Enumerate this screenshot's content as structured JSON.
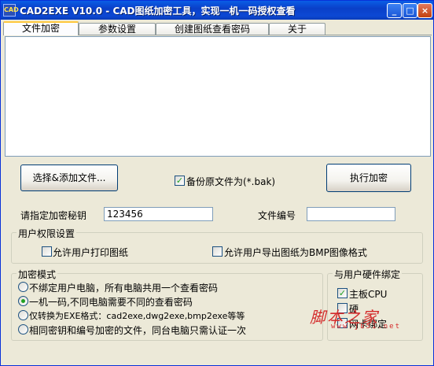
{
  "window": {
    "title": "CAD2EXE V10.0 - CAD图纸加密工具，实现一机一码授权查看",
    "icon_label": "CAD",
    "controls": {
      "minimize": "_",
      "maximize": "□",
      "close": "×"
    }
  },
  "tabs": [
    {
      "label": "文件加密",
      "active": true
    },
    {
      "label": "参数设置",
      "active": false
    },
    {
      "label": "创建图纸查看密码",
      "active": false
    },
    {
      "label": "关于",
      "active": false
    }
  ],
  "file_list": {
    "items": []
  },
  "actions": {
    "add_files_label": "选择&添加文件...",
    "backup_label": "备份原文件为(*.bak)",
    "backup_checked": true,
    "execute_label": "执行加密"
  },
  "fields": {
    "key_label": "请指定加密秘钥",
    "key_value": "123456",
    "file_number_label": "文件编号",
    "file_number_value": ""
  },
  "permissions": {
    "title": "用户权限设置",
    "allow_print_label": "允许用户打印图纸",
    "allow_print_checked": false,
    "allow_export_label": "允许用户导出图纸为BMP图像格式",
    "allow_export_checked": false
  },
  "encryption_mode": {
    "title": "加密模式",
    "options": [
      {
        "label": "不绑定用户电脑，所有电脑共用一个查看密码",
        "selected": false
      },
      {
        "label": "一机一码,不同电脑需要不同的查看密码",
        "selected": true
      },
      {
        "label": "仅转换为EXE格式：cad2exe,dwg2exe,bmp2exe等等",
        "selected": false
      },
      {
        "label": "相同密钥和编号加密的文件，同台电脑只需认证一次",
        "selected": false
      }
    ]
  },
  "hardware_binding": {
    "title": "与用户硬件绑定",
    "options": [
      {
        "label": "主板CPU",
        "checked": true
      },
      {
        "label": "硬",
        "checked": false
      },
      {
        "label": "网卡绑定",
        "checked": false
      }
    ]
  },
  "watermark": {
    "text": "脚本之家",
    "sub": "www.jb51.net"
  },
  "colors": {
    "titlebar": "#0a3fc8",
    "window_bg": "#ece9d8",
    "check_mark": "#21a121",
    "watermark": "#d42a2a"
  }
}
